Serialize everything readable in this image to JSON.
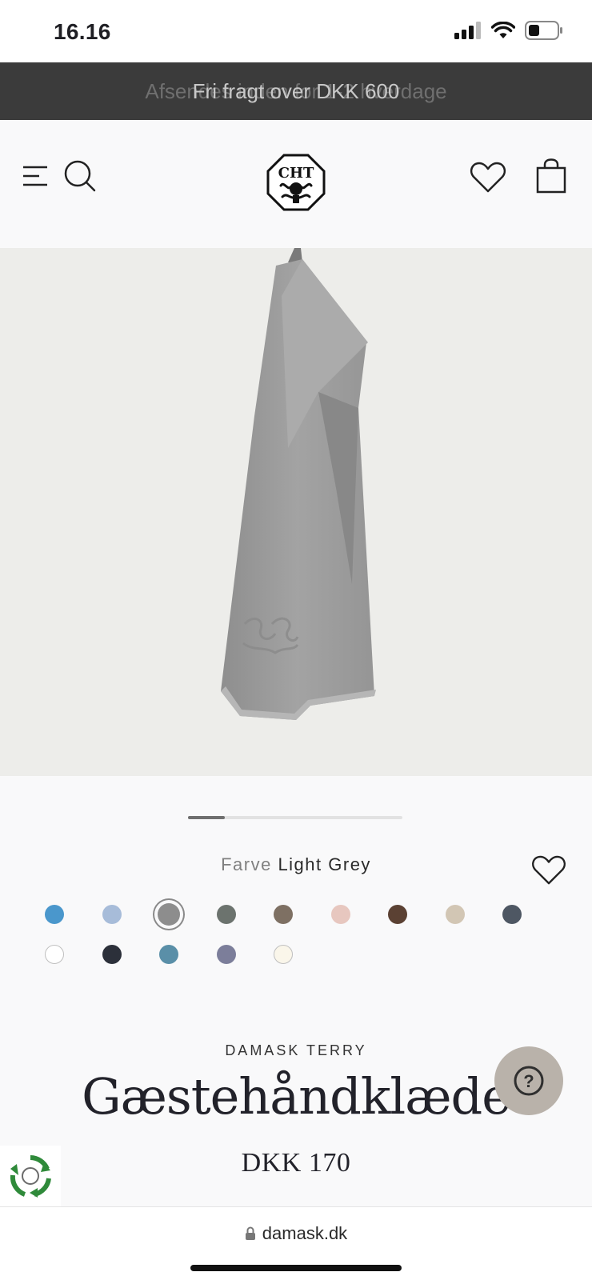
{
  "status_bar": {
    "time": "16.16"
  },
  "announcement": {
    "text": "Fri fragt over DKK 600",
    "ghost_text": "Afsendes inden for 1-2 hverdage"
  },
  "header": {
    "menu_icon": "hamburger-icon",
    "search_icon": "search-icon",
    "logo_icon": "damask-logo-icon",
    "wishlist_icon": "heart-icon",
    "cart_icon": "shopping-bag-icon"
  },
  "gallery": {
    "progress": 0.17
  },
  "color": {
    "label": "Farve",
    "value": "Light Grey",
    "swatches": [
      {
        "color": "#4a97cc"
      },
      {
        "color": "#a7bcd9"
      },
      {
        "color": "#8d8d8d",
        "selected": true
      },
      {
        "color": "#6c736e"
      },
      {
        "color": "#7e7063"
      },
      {
        "color": "#e7c7bf"
      },
      {
        "color": "#5b4133"
      },
      {
        "color": "#d2c6b4"
      },
      {
        "color": "#4e5763"
      },
      {
        "color": "#ffffff"
      },
      {
        "color": "#2c303a"
      },
      {
        "color": "#5a8fa8"
      },
      {
        "color": "#7c7e9a"
      },
      {
        "color": "#faf6ea"
      }
    ]
  },
  "product": {
    "brand": "DAMASK TERRY",
    "title": "Gæstehåndklæde",
    "price": "DKK 170"
  },
  "help": {
    "label": "?"
  },
  "browser": {
    "url": "damask.dk"
  }
}
